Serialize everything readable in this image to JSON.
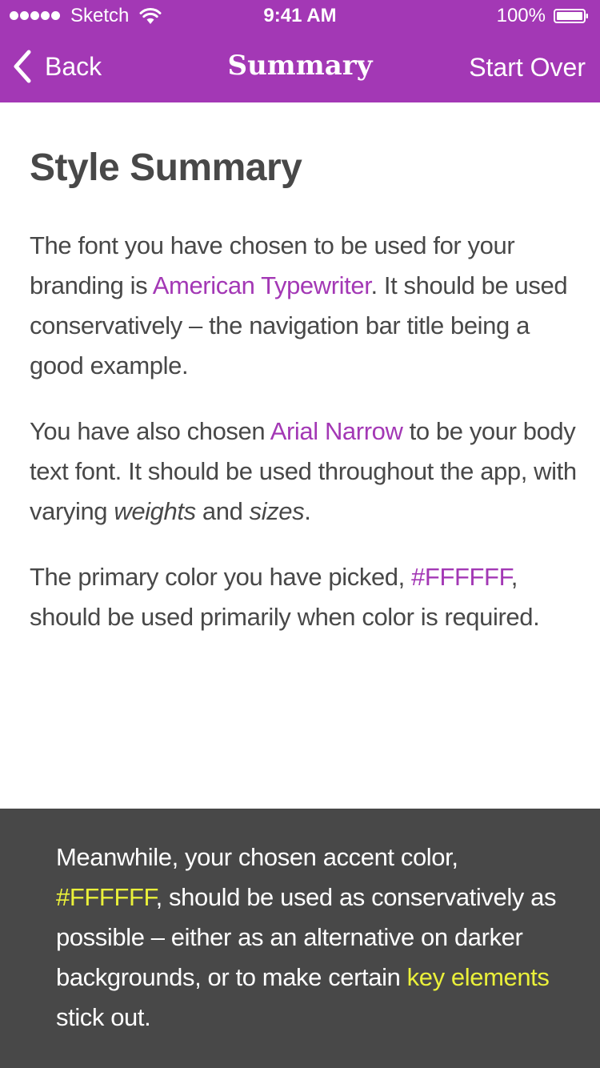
{
  "status_bar": {
    "carrier": "Sketch",
    "time": "9:41 AM",
    "battery": "100%"
  },
  "nav": {
    "back_label": "Back",
    "title": "Summary",
    "start_over": "Start Over"
  },
  "content": {
    "heading": "Style Summary",
    "p1": {
      "before": "The font you have chosen to be used for your branding is ",
      "highlight": "American Typewriter",
      "after": ". It should be used conservatively – the navigation bar title being a good example."
    },
    "p2": {
      "before": "You have also chosen ",
      "highlight": "Arial Narrow",
      "middle": " to be your body text font. It should be used throughout the app, with varying ",
      "em1": "weights",
      "and": " and ",
      "em2": "sizes",
      "end": "."
    },
    "p3": {
      "before": "The primary color you have picked, ",
      "highlight": "#FFFFFF",
      "after": ", should be used primarily when color is required."
    }
  },
  "footer": {
    "before": "Meanwhile, your chosen accent color, ",
    "accent1": "#FFFFFF",
    "middle": ", should be used as conservatively as possible – either as an alternative on darker backgrounds, or to make certain ",
    "accent2": "key elements",
    "after": " stick out."
  },
  "colors": {
    "brand_purple": "#a338b5",
    "body_text": "#484848",
    "footer_background": "#484848",
    "accent_yellow": "#eaf03a"
  },
  "icons": [
    "signal-dots-icon",
    "wifi-icon",
    "battery-icon",
    "chevron-left-icon"
  ]
}
